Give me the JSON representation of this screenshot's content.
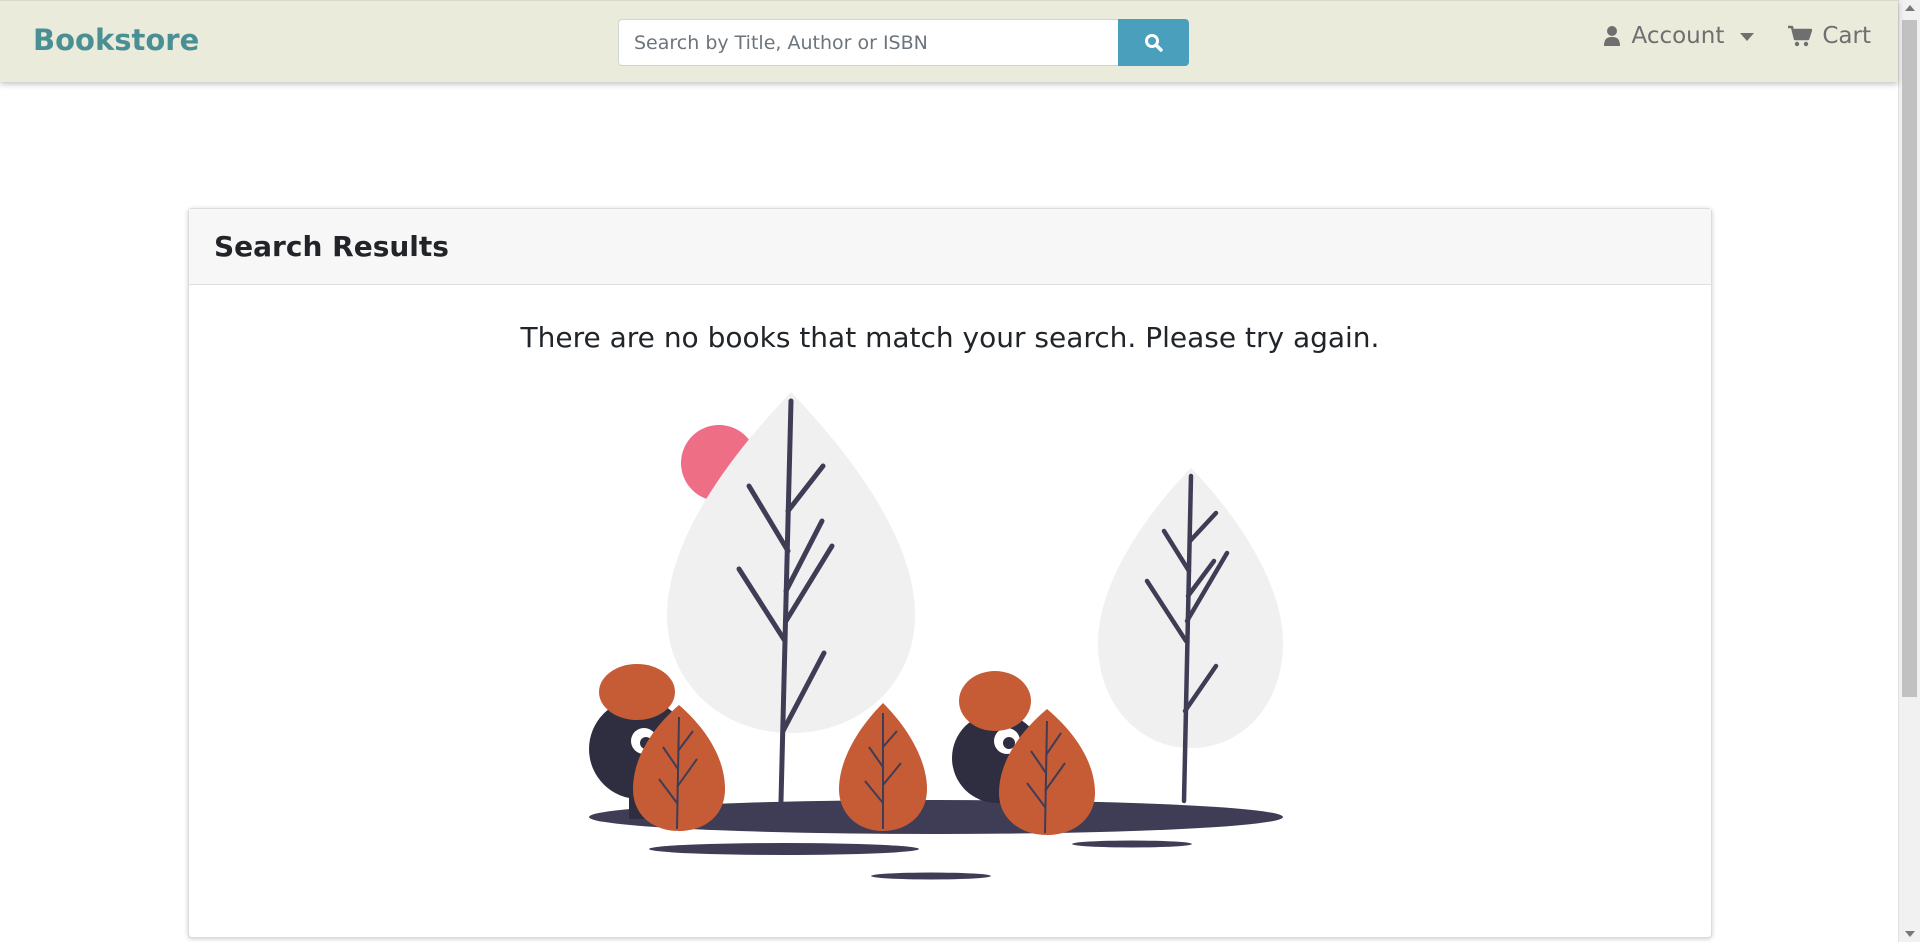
{
  "navbar": {
    "brand": "Bookstore",
    "search": {
      "placeholder": "Search by Title, Author or ISBN",
      "value": "",
      "button_icon": "search-icon"
    },
    "account": {
      "label": "Account",
      "icon": "user-icon"
    },
    "cart": {
      "label": "Cart",
      "icon": "shopping-cart-icon"
    }
  },
  "results": {
    "title": "Search Results",
    "message": "There are no books that match your search. Please try again."
  },
  "colors": {
    "navbar_bg": "#ebebdb",
    "brand": "#4a8f94",
    "search_button": "#4a9fbd",
    "accent_orange": "#c65c36",
    "accent_pink": "#ee6e85",
    "dark": "#3f3d56"
  }
}
